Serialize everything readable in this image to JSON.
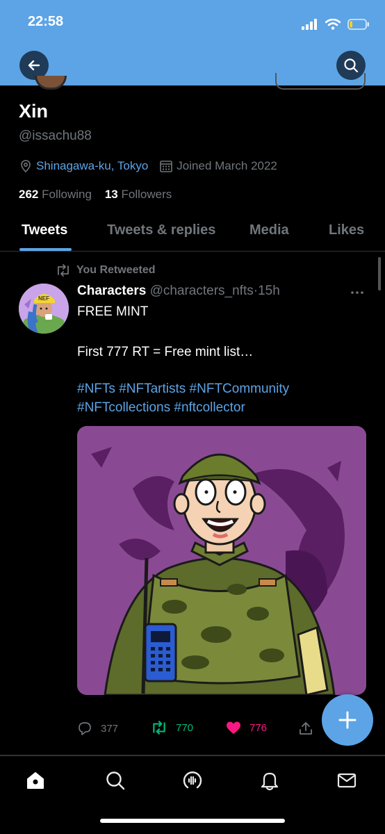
{
  "status_bar": {
    "time": "22:58"
  },
  "profile": {
    "name": "Xin",
    "handle": "@issachu88",
    "location": "Shinagawa-ku, Tokyo",
    "joined": "Joined March 2022",
    "following_count": "262",
    "following_label": "Following",
    "followers_count": "13",
    "followers_label": "Followers"
  },
  "tabs": [
    {
      "label": "Tweets",
      "active": true
    },
    {
      "label": "Tweets & replies"
    },
    {
      "label": "Media"
    },
    {
      "label": "Likes"
    }
  ],
  "tweet": {
    "retweet_label": "You Retweeted",
    "author": "Characters",
    "author_handle": "@characters_nfts",
    "separator": "·",
    "time": "15h",
    "line1": "FREE MINT",
    "line2": "First 777 RT = Free mint list…",
    "hashtags_line1": [
      "#NFTs",
      "#NFTartists",
      "#NFTCommunity"
    ],
    "hashtags_line2": [
      "#NFTcollections",
      "#nftcollector"
    ],
    "avatar_cap_text": "NEF",
    "replies": "377",
    "retweets": "770",
    "likes": "776"
  },
  "colors": {
    "accent": "#5da4e6",
    "retweet_green": "#00ba7c",
    "like_pink": "#f91880",
    "media_bg": "#8a4a93"
  },
  "icons": {
    "back": "arrow-left-icon",
    "search": "search-icon",
    "location": "location-pin-icon",
    "calendar": "calendar-icon",
    "retweet": "retweet-icon",
    "more": "more-dots-icon",
    "reply": "reply-icon",
    "like": "heart-icon",
    "share": "share-icon",
    "compose": "plus-icon",
    "nav": [
      "home-icon",
      "search-icon",
      "spaces-icon",
      "notifications-icon",
      "messages-icon"
    ]
  }
}
